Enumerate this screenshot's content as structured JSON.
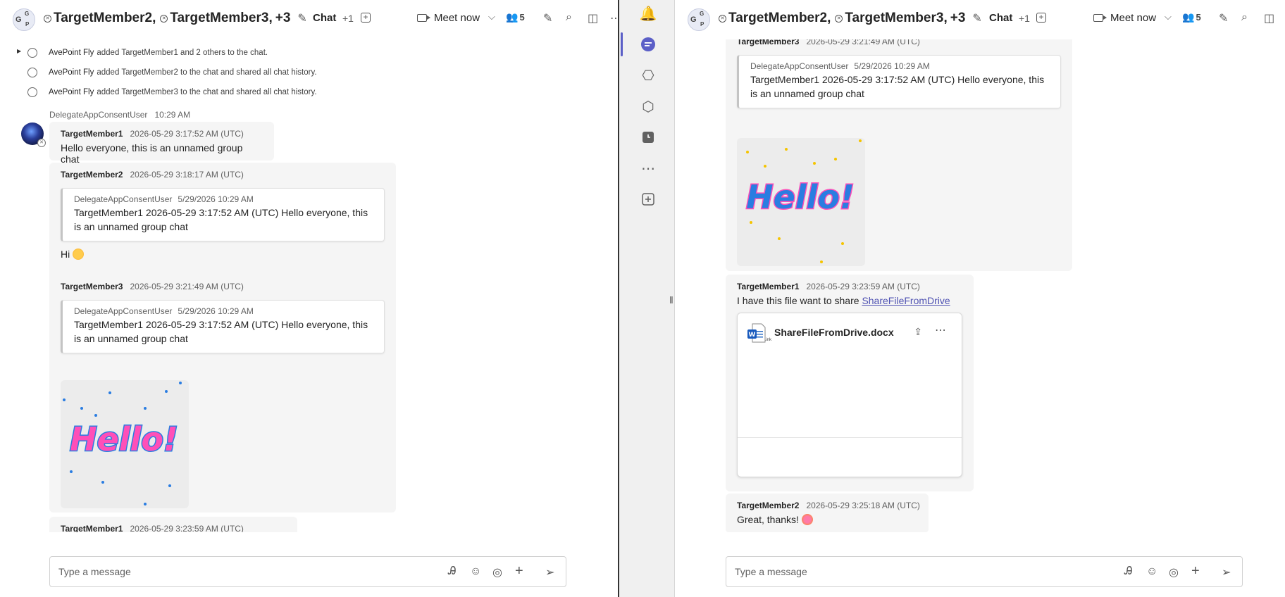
{
  "header": {
    "avatar_letters": [
      "G",
      "G",
      "P"
    ],
    "title_part1": "TargetMember2,",
    "title_part2": "TargetMember3,",
    "title_more": "+3",
    "chat_tab": "Chat",
    "plus_tabs": "+1",
    "meet_now": "Meet now",
    "participants_count": "5"
  },
  "system_events": [
    {
      "actor": "AvePoint Fly",
      "text": "added TargetMember1 and 2 others to the chat."
    },
    {
      "actor": "AvePoint Fly",
      "text": "added TargetMember2 to the chat and shared all chat history."
    },
    {
      "actor": "AvePoint Fly",
      "text": "added TargetMember3 to the chat and shared all chat history."
    }
  ],
  "sender": {
    "name": "DelegateAppConsentUser",
    "time": "10:29 AM"
  },
  "messages": {
    "m1": {
      "name": "TargetMember1",
      "time": "2026-05-29 3:17:52 AM (UTC)",
      "text": "Hello everyone, this is an unnamed group chat"
    },
    "m2": {
      "name": "TargetMember2",
      "time": "2026-05-29 3:18:17 AM (UTC)",
      "text": "Hi"
    },
    "m3": {
      "name": "TargetMember3",
      "time": "2026-05-29 3:21:49 AM (UTC)"
    },
    "m4": {
      "name": "TargetMember1",
      "time": "2026-05-29 3:23:59 AM (UTC)",
      "text": "I have this file want to share",
      "link": "ShareFileFromDrive"
    },
    "m5": {
      "name": "TargetMember2",
      "time": "2026-05-29 3:25:18 AM (UTC)",
      "text": "Great, thanks!"
    }
  },
  "quote": {
    "author": "DelegateAppConsentUser",
    "time": "5/29/2026 10:29 AM",
    "text": "TargetMember1 2026-05-29 3:17:52 AM (UTC) Hello everyone, this is an unnamed group chat"
  },
  "sticker_text": "Hello!",
  "file": {
    "preview_label": "Link",
    "name": "ShareFileFromDrive.docx"
  },
  "composer": {
    "placeholder": "Type a message"
  },
  "colors": {
    "accent": "#5b5fc7",
    "link": "#4f52b2",
    "bubble": "#f5f5f5"
  }
}
